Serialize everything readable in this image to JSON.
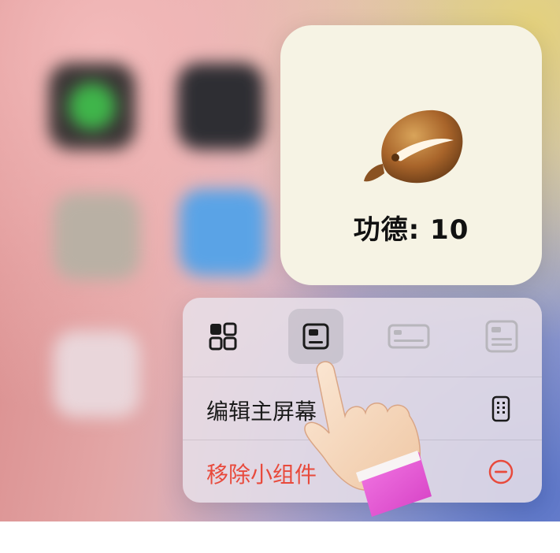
{
  "widget": {
    "image_icon": "wooden-fish-icon",
    "merit_text": "功德: 10"
  },
  "menu": {
    "size_options": [
      {
        "icon": "small-widget-icon",
        "selected": false
      },
      {
        "icon": "medium-widget-icon",
        "selected": true
      },
      {
        "icon": "large-widget-icon",
        "selected": false
      },
      {
        "icon": "extra-large-widget-icon",
        "selected": false
      }
    ],
    "edit_home_label": "编辑主屏幕",
    "edit_home_icon": "phone-icon",
    "remove_widget_label": "移除小组件",
    "remove_widget_icon": "minus-circle-icon"
  },
  "colors": {
    "destructive": "#e84a3c",
    "widget_bg": "#f6f3e4"
  }
}
